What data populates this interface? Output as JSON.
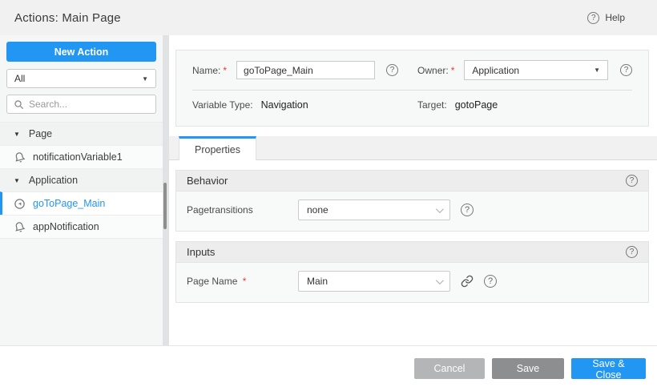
{
  "header": {
    "title": "Actions: Main Page",
    "help_label": "Help"
  },
  "icons": {
    "question_mark": "?",
    "caret_down": "▼"
  },
  "sidebar": {
    "new_action_label": "New Action",
    "filter_value": "All",
    "search_placeholder": "Search...",
    "tree": [
      {
        "type": "group",
        "label": "Page"
      },
      {
        "type": "item",
        "icon": "bell-icon",
        "label": "notificationVariable1",
        "selected": false
      },
      {
        "type": "group",
        "label": "Application"
      },
      {
        "type": "item",
        "icon": "navigation-icon",
        "label": "goToPage_Main",
        "selected": true
      },
      {
        "type": "item",
        "icon": "bell-icon",
        "label": "appNotification",
        "selected": false
      }
    ]
  },
  "form": {
    "name_label": "Name:",
    "name_value": "goToPage_Main",
    "owner_label": "Owner:",
    "owner_value": "Application",
    "variable_type_label": "Variable Type:",
    "variable_type_value": "Navigation",
    "target_label": "Target:",
    "target_value": "gotoPage",
    "required_marker": "*"
  },
  "tabs": {
    "active_label": "Properties"
  },
  "sections": [
    {
      "title": "Behavior",
      "field_label": "Pagetransitions",
      "field_value": "none"
    },
    {
      "title": "Inputs",
      "field_label": "Page Name",
      "field_value": "Main"
    }
  ],
  "footer": {
    "cancel_label": "Cancel",
    "save_label": "Save",
    "save_close_label": "Save & Close"
  },
  "colors": {
    "accent": "#2196f3",
    "required": "#e53935",
    "cancel_bg": "#b4b5b6",
    "save_bg": "#8d8e8f"
  }
}
